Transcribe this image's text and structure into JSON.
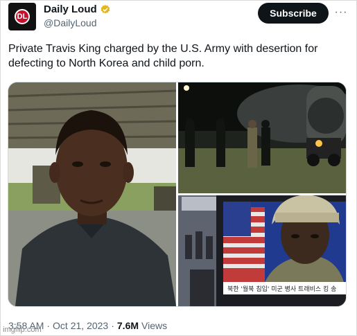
{
  "author": {
    "display_name": "Daily Loud",
    "handle": "@DailyLoud",
    "verified": true,
    "avatar_logo_text": "DL"
  },
  "actions": {
    "subscribe_label": "Subscribe",
    "more_label": "···"
  },
  "tweet": {
    "text": "Private Travis King charged by the U.S. Army with desertion for defecting to North Korea and child porn."
  },
  "media": {
    "news_caption": "북한 '월북 침입' 미군 병사 트래비스 킹 송"
  },
  "footer": {
    "time": "3:58 AM",
    "date": "Oct 21, 2023",
    "views_count": "7.6M",
    "views_label": "Views",
    "separator": "·"
  },
  "watermark": "imgflip.com",
  "colors": {
    "text_primary": "#0f1419",
    "text_secondary": "#536471",
    "verified_gold": "#e2b719",
    "subscribe_bg": "#0f1419"
  }
}
